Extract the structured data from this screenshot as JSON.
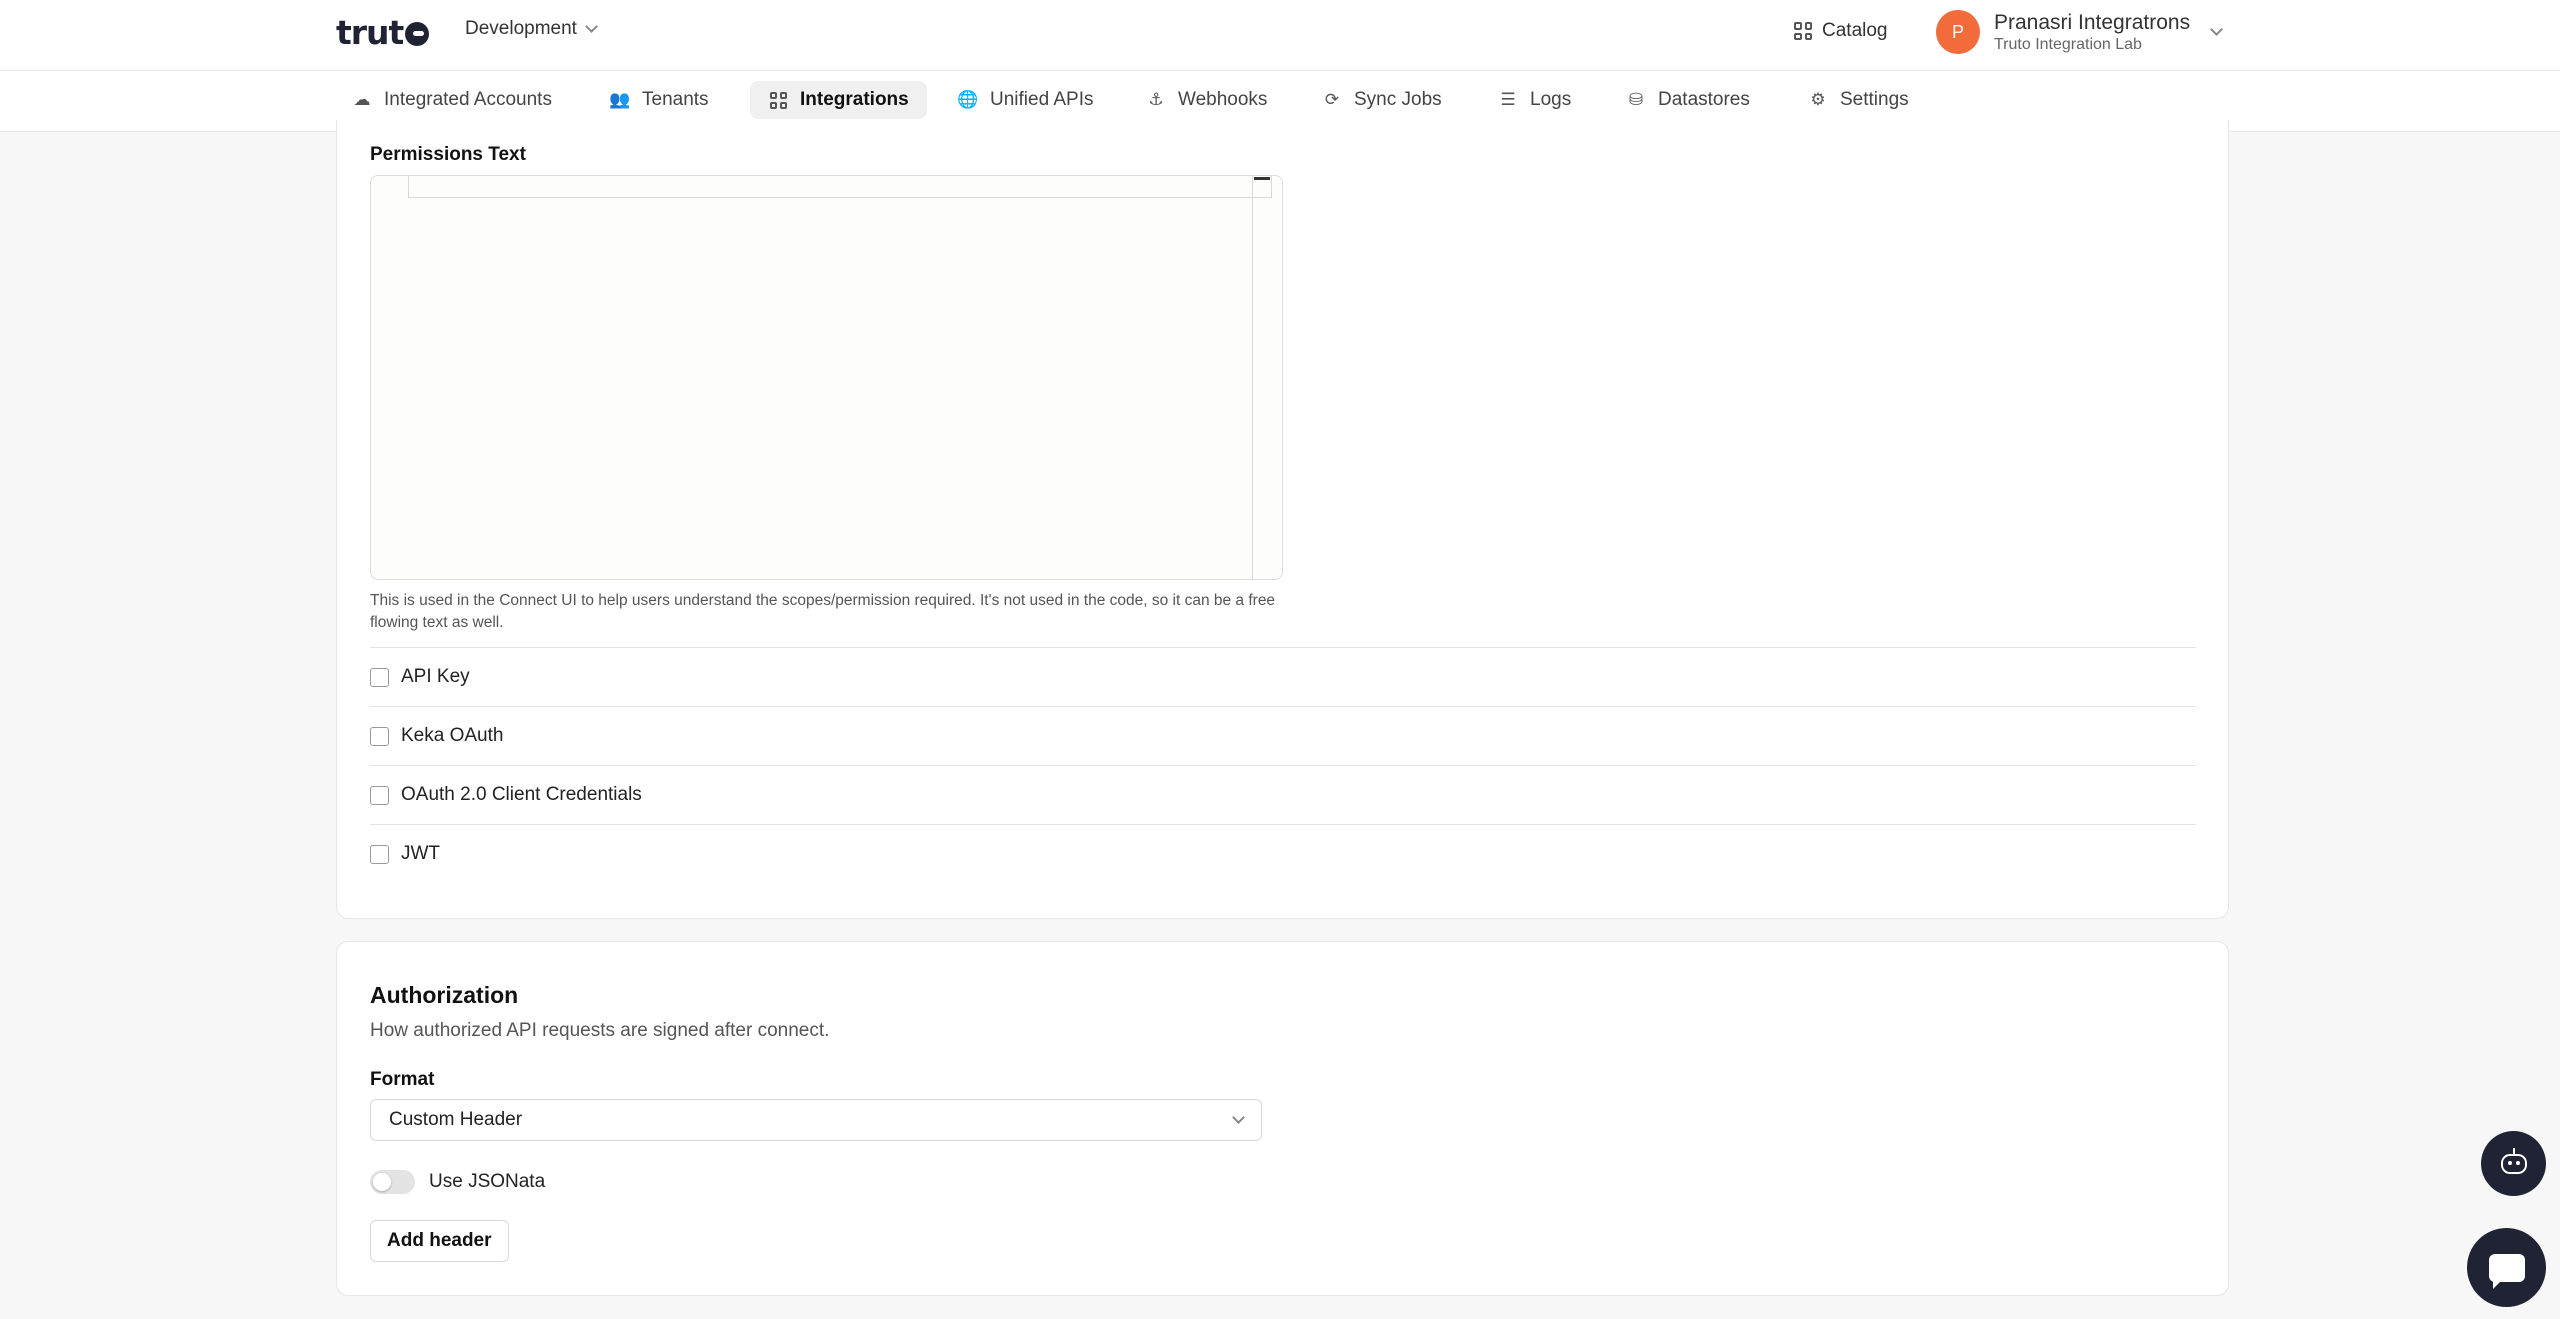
{
  "header": {
    "logo_text": "truto",
    "environment": "Development",
    "catalog_label": "Catalog",
    "user": {
      "initial": "P",
      "name": "Pranasri Integratrons",
      "org": "Truto Integration Lab"
    }
  },
  "nav": {
    "items": [
      {
        "label": "Integrated Accounts",
        "icon": "cloud-icon"
      },
      {
        "label": "Tenants",
        "icon": "users-icon"
      },
      {
        "label": "Integrations",
        "icon": "grid-icon",
        "active": true
      },
      {
        "label": "Unified APIs",
        "icon": "globe-icon"
      },
      {
        "label": "Webhooks",
        "icon": "webhook-icon"
      },
      {
        "label": "Sync Jobs",
        "icon": "sync-icon"
      },
      {
        "label": "Logs",
        "icon": "list-icon"
      },
      {
        "label": "Datastores",
        "icon": "database-icon"
      },
      {
        "label": "Settings",
        "icon": "gear-icon"
      }
    ]
  },
  "permissions": {
    "label": "Permissions Text",
    "value": "",
    "help": "This is used in the Connect UI to help users understand the scopes/permission required. It's not used in the code, so it can be a free flowing text as well."
  },
  "auth_methods": [
    {
      "label": "API Key",
      "checked": false
    },
    {
      "label": "Keka OAuth",
      "checked": false
    },
    {
      "label": "OAuth 2.0 Client Credentials",
      "checked": false
    },
    {
      "label": "JWT",
      "checked": false
    }
  ],
  "authorization": {
    "title": "Authorization",
    "subtitle": "How authorized API requests are signed after connect.",
    "format_label": "Format",
    "format_value": "Custom Header",
    "toggle_label": "Use JSONata",
    "toggle_on": false,
    "add_header_label": "Add header"
  },
  "colors": {
    "brand": "#1f2333",
    "avatar": "#f26b3a",
    "active_nav_bg": "#f0f0f0"
  }
}
